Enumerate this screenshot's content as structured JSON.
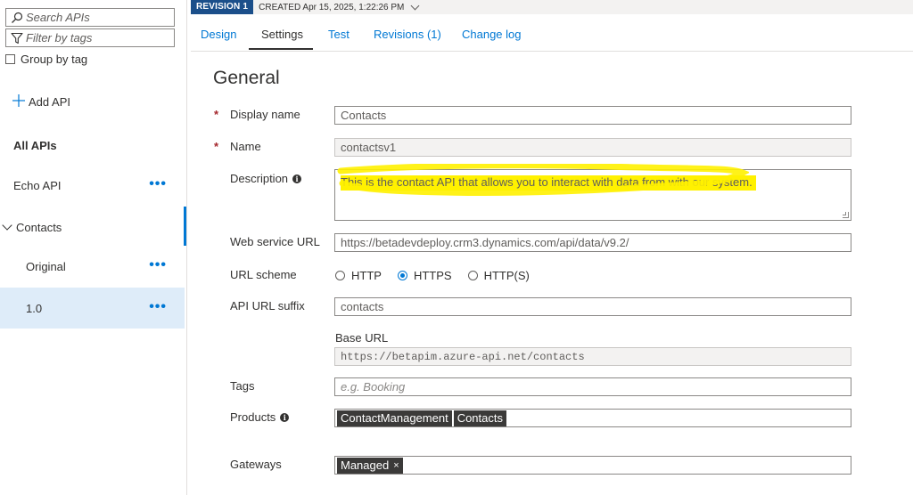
{
  "sidebar": {
    "search_placeholder": "Search APIs",
    "filter_placeholder": "Filter by tags",
    "group_by_tag": "Group by tag",
    "add_api": "Add API",
    "all_apis": "All APIs",
    "items": [
      {
        "label": "Echo API",
        "more": "•••"
      },
      {
        "label": "Contacts"
      },
      {
        "label": "Original",
        "more": "•••"
      },
      {
        "label": "1.0",
        "more": "•••"
      }
    ]
  },
  "topbar": {
    "revision": "REVISION 1",
    "created": "CREATED Apr 15, 2025, 1:22:26 PM"
  },
  "tabs": [
    "Design",
    "Settings",
    "Test",
    "Revisions (1)",
    "Change log"
  ],
  "form": {
    "section_title": "General",
    "display_name": {
      "label": "Display name",
      "value": "Contacts",
      "required": "*"
    },
    "name": {
      "label": "Name",
      "value": "contactsv1",
      "required": "*"
    },
    "description": {
      "label": "Description",
      "value": "This is the contact API that allows you to interact with data from with our system."
    },
    "web_service_url": {
      "label": "Web service URL",
      "value": "https://betadevdeploy.crm3.dynamics.com/api/data/v9.2/"
    },
    "url_scheme": {
      "label": "URL scheme",
      "options": [
        "HTTP",
        "HTTPS",
        "HTTP(S)"
      ],
      "selected": "HTTPS"
    },
    "api_url_suffix": {
      "label": "API URL suffix",
      "value": "contacts"
    },
    "base_url": {
      "label": "Base URL",
      "value": "https://betapim.azure-api.net/contacts"
    },
    "tags": {
      "label": "Tags",
      "placeholder": "e.g. Booking"
    },
    "products": {
      "label": "Products",
      "items": [
        "ContactManagement",
        "Contacts"
      ]
    },
    "gateways": {
      "label": "Gateways",
      "items": [
        "Managed"
      ],
      "remove": "×"
    }
  },
  "colors": {
    "accent": "#0078d4",
    "revision_badge": "#1b4f8a",
    "highlight": "#fff100",
    "selected_row": "#deecf9"
  }
}
